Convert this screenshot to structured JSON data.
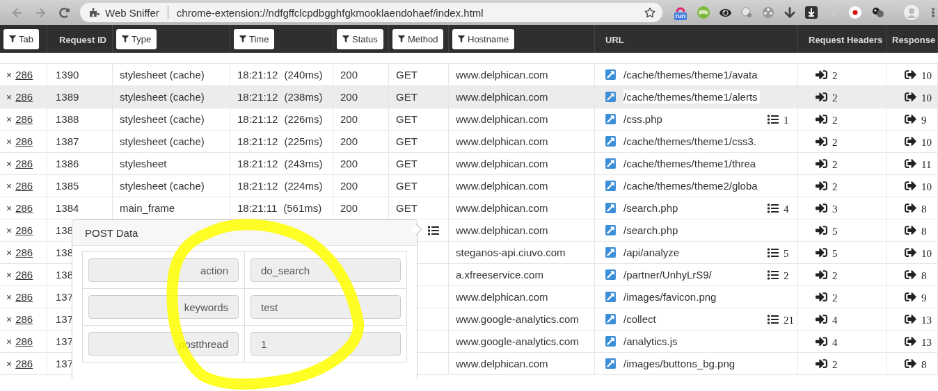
{
  "browser": {
    "page_title": "Web Sniffer",
    "url": "chrome-extension://ndfgffclcpdbgghfgkmooklaendohaef/index.html",
    "extension_badge": "run"
  },
  "table": {
    "columns": [
      {
        "label": "Tab",
        "filter": true
      },
      {
        "label": "Request ID",
        "filter": false
      },
      {
        "label": "Type",
        "filter": true
      },
      {
        "label": "Time",
        "filter": true
      },
      {
        "label": "Status",
        "filter": true
      },
      {
        "label": "Method",
        "filter": true
      },
      {
        "label": "Hostname",
        "filter": true
      },
      {
        "label": "URL",
        "filter": false
      },
      {
        "label": "Request Headers",
        "filter": false
      },
      {
        "label": "Response",
        "filter": false
      }
    ],
    "rows": [
      {
        "close": "×",
        "tab": "286",
        "id": "1390",
        "type": "stylesheet (cache)",
        "time": "18:21:12",
        "duration": "(240ms)",
        "status": "200",
        "method": "GET",
        "hostname": "www.delphican.com",
        "url": "/cache/themes/theme1/avata",
        "request_headers": "2",
        "response_headers": "10",
        "selected": false,
        "post_data_open": false
      },
      {
        "close": "×",
        "tab": "286",
        "id": "1389",
        "type": "stylesheet (cache)",
        "time": "18:21:12",
        "duration": "(238ms)",
        "status": "200",
        "method": "GET",
        "hostname": "www.delphican.com",
        "url": "/cache/themes/theme1/alerts",
        "request_headers": "2",
        "response_headers": "10",
        "selected": true,
        "post_data_open": false
      },
      {
        "close": "×",
        "tab": "286",
        "id": "1388",
        "type": "stylesheet (cache)",
        "time": "18:21:12",
        "duration": "(226ms)",
        "status": "200",
        "method": "GET",
        "hostname": "www.delphican.com",
        "url": "/css.php",
        "post_count": "1",
        "request_headers": "2",
        "response_headers": "9",
        "selected": false,
        "post_data_open": false
      },
      {
        "close": "×",
        "tab": "286",
        "id": "1387",
        "type": "stylesheet (cache)",
        "time": "18:21:12",
        "duration": "(225ms)",
        "status": "200",
        "method": "GET",
        "hostname": "www.delphican.com",
        "url": "/cache/themes/theme1/css3.",
        "request_headers": "2",
        "response_headers": "10",
        "selected": false,
        "post_data_open": false
      },
      {
        "close": "×",
        "tab": "286",
        "id": "1386",
        "type": "stylesheet",
        "time": "18:21:12",
        "duration": "(243ms)",
        "status": "200",
        "method": "GET",
        "hostname": "www.delphican.com",
        "url": "/cache/themes/theme1/threa",
        "request_headers": "2",
        "response_headers": "11",
        "selected": false,
        "post_data_open": false
      },
      {
        "close": "×",
        "tab": "286",
        "id": "1385",
        "type": "stylesheet (cache)",
        "time": "18:21:12",
        "duration": "(224ms)",
        "status": "200",
        "method": "GET",
        "hostname": "www.delphican.com",
        "url": "/cache/themes/theme2/globa",
        "request_headers": "2",
        "response_headers": "10",
        "selected": false,
        "post_data_open": false
      },
      {
        "close": "×",
        "tab": "286",
        "id": "1384",
        "type": "main_frame",
        "time": "18:21:11",
        "duration": "(561ms)",
        "status": "200",
        "method": "GET",
        "hostname": "www.delphican.com",
        "url": "/search.php",
        "post_count": "4",
        "request_headers": "3",
        "response_headers": "8",
        "selected": false,
        "post_data_open": false
      },
      {
        "close": "×",
        "tab": "286",
        "id": "138",
        "hostname": "www.delphican.com",
        "url": "/search.php",
        "request_headers": "5",
        "response_headers": "8",
        "selected": false,
        "post_data_open": true
      },
      {
        "close": "×",
        "tab": "286",
        "id": "138",
        "hostname": "steganos-api.ciuvo.com",
        "url": "/api/analyze",
        "post_count": "5",
        "request_headers": "5",
        "response_headers": "10",
        "selected": false,
        "post_data_open": false
      },
      {
        "close": "×",
        "tab": "286",
        "id": "138",
        "hostname": "a.xfreeservice.com",
        "url": "/partner/UnhyLrS9/",
        "post_count": "2",
        "request_headers": "2",
        "response_headers": "8",
        "selected": false,
        "post_data_open": false
      },
      {
        "close": "×",
        "tab": "286",
        "id": "137",
        "hostname": "www.delphican.com",
        "url": "/images/favicon.png",
        "request_headers": "2",
        "response_headers": "9",
        "selected": false,
        "post_data_open": false
      },
      {
        "close": "×",
        "tab": "286",
        "id": "137",
        "hostname": "www.google-analytics.com",
        "url": "/collect",
        "post_count": "21",
        "request_headers": "4",
        "response_headers": "13",
        "selected": false,
        "post_data_open": false
      },
      {
        "close": "×",
        "tab": "286",
        "id": "137",
        "hostname": "www.google-analytics.com",
        "url": "/analytics.js",
        "request_headers": "4",
        "response_headers": "13",
        "selected": false,
        "post_data_open": false
      },
      {
        "close": "×",
        "tab": "286",
        "id": "137",
        "hostname": "www.delphican.com",
        "url": "/images/buttons_bg.png",
        "request_headers": "2",
        "response_headers": "8",
        "selected": false,
        "post_data_open": false
      }
    ]
  },
  "popup": {
    "title": "POST Data",
    "fields": [
      {
        "name": "action",
        "value": "do_search"
      },
      {
        "name": "keywords",
        "value": "test"
      },
      {
        "name": "postthread",
        "value": "1"
      }
    ]
  }
}
